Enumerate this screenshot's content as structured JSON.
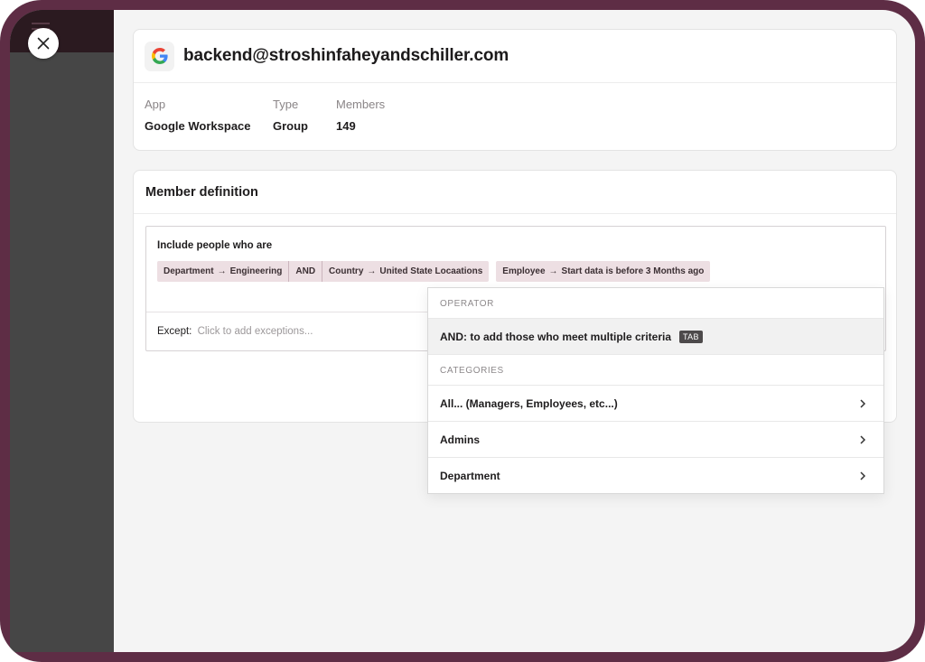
{
  "group": {
    "email": "backend@stroshinfaheyandschiller.com",
    "app_logo_icon": "google-g-logo",
    "meta": [
      {
        "label": "App",
        "value": "Google Workspace"
      },
      {
        "label": "Type",
        "value": "Group"
      },
      {
        "label": "Members",
        "value": "149"
      }
    ]
  },
  "definition": {
    "title": "Member definition",
    "include_label": "Include people who are",
    "rule_chips": {
      "first": {
        "field": "Department",
        "value": "Engineering"
      },
      "operator": "AND",
      "second": {
        "field": "Country",
        "value": "United State Locaations"
      }
    },
    "rule_chip_2": {
      "field": "Employee",
      "value": "Start data is before 3 Months ago"
    },
    "except_label": "Except:",
    "except_placeholder": "Click to add exceptions..."
  },
  "dropdown": {
    "operator_header": "OPERATOR",
    "operator_item": "AND: to add those who meet multiple criteria",
    "operator_key": "TAB",
    "categories_header": "CATEGORIES",
    "categories": [
      {
        "label": "All... (Managers, Employees, etc...)"
      },
      {
        "label": "Admins"
      },
      {
        "label": "Department"
      }
    ]
  },
  "colors": {
    "frame": "#5e2d45",
    "chip_bg": "#eddfe3",
    "sidebar": "#464646"
  }
}
